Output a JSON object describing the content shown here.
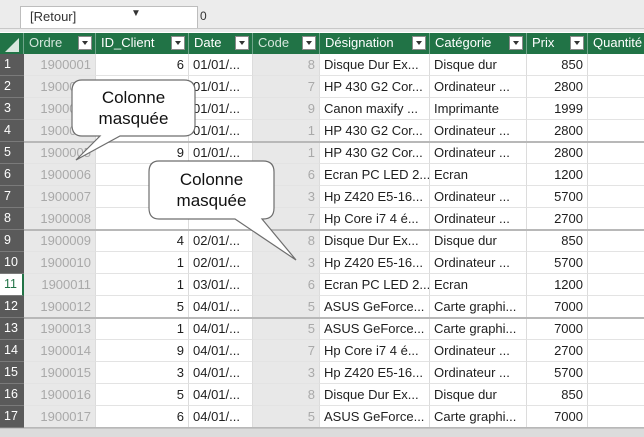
{
  "topbar": {
    "namebox_value": "[Retour]",
    "formula_value": "0"
  },
  "columns": [
    {
      "label": "Ordre",
      "hidden": true
    },
    {
      "label": "ID_Client",
      "hidden": false
    },
    {
      "label": "Date",
      "hidden": false
    },
    {
      "label": "Code",
      "hidden": true
    },
    {
      "label": "Désignation",
      "hidden": false
    },
    {
      "label": "Catégorie",
      "hidden": false
    },
    {
      "label": "Prix",
      "hidden": false
    },
    {
      "label": "Quantité",
      "hidden": false
    }
  ],
  "rows": [
    {
      "n": "1",
      "ordre": "1900001",
      "id": "6",
      "date": "01/01/...",
      "code": "8",
      "des": "Disque Dur Ex...",
      "cat": "Disque dur",
      "prix": "850"
    },
    {
      "n": "2",
      "ordre": "1900002",
      "id": "",
      "date": "01/01/...",
      "code": "7",
      "des": "HP 430 G2 Cor...",
      "cat": "Ordinateur ...",
      "prix": "2800"
    },
    {
      "n": "3",
      "ordre": "1900003",
      "id": "",
      "date": "01/01/...",
      "code": "9",
      "des": "Canon maxify ...",
      "cat": "Imprimante",
      "prix": "1999"
    },
    {
      "n": "4",
      "ordre": "1900004",
      "id": "",
      "date": "01/01/...",
      "code": "1",
      "des": "HP 430 G2 Cor...",
      "cat": "Ordinateur ...",
      "prix": "2800"
    },
    {
      "n": "5",
      "ordre": "1900005",
      "id": "9",
      "date": "01/01/...",
      "code": "1",
      "des": "HP 430 G2 Cor...",
      "cat": "Ordinateur ...",
      "prix": "2800"
    },
    {
      "n": "6",
      "ordre": "1900006",
      "id": "",
      "date": "",
      "code": "6",
      "des": "Ecran PC LED 2...",
      "cat": "Ecran",
      "prix": "1200"
    },
    {
      "n": "7",
      "ordre": "1900007",
      "id": "",
      "date": "",
      "code": "3",
      "des": "Hp Z420 E5-16...",
      "cat": "Ordinateur ...",
      "prix": "5700"
    },
    {
      "n": "8",
      "ordre": "1900008",
      "id": "",
      "date": "",
      "code": "7",
      "des": "Hp Core i7 4 é...",
      "cat": "Ordinateur ...",
      "prix": "2700"
    },
    {
      "n": "9",
      "ordre": "1900009",
      "id": "4",
      "date": "02/01/...",
      "code": "8",
      "des": "Disque Dur Ex...",
      "cat": "Disque dur",
      "prix": "850"
    },
    {
      "n": "10",
      "ordre": "1900010",
      "id": "1",
      "date": "02/01/...",
      "code": "3",
      "des": "Hp Z420 E5-16...",
      "cat": "Ordinateur ...",
      "prix": "5700"
    },
    {
      "n": "11",
      "ordre": "1900011",
      "id": "1",
      "date": "03/01/...",
      "code": "6",
      "des": "Ecran PC LED 2...",
      "cat": "Ecran",
      "prix": "1200"
    },
    {
      "n": "12",
      "ordre": "1900012",
      "id": "5",
      "date": "04/01/...",
      "code": "5",
      "des": "ASUS GeForce...",
      "cat": "Carte graphi...",
      "prix": "7000"
    },
    {
      "n": "13",
      "ordre": "1900013",
      "id": "1",
      "date": "04/01/...",
      "code": "5",
      "des": "ASUS GeForce...",
      "cat": "Carte graphi...",
      "prix": "7000"
    },
    {
      "n": "14",
      "ordre": "1900014",
      "id": "9",
      "date": "04/01/...",
      "code": "7",
      "des": "Hp Core i7 4 é...",
      "cat": "Ordinateur ...",
      "prix": "2700"
    },
    {
      "n": "15",
      "ordre": "1900015",
      "id": "3",
      "date": "04/01/...",
      "code": "3",
      "des": "Hp Z420 E5-16...",
      "cat": "Ordinateur ...",
      "prix": "5700"
    },
    {
      "n": "16",
      "ordre": "1900016",
      "id": "5",
      "date": "04/01/...",
      "code": "8",
      "des": "Disque Dur Ex...",
      "cat": "Disque dur",
      "prix": "850"
    },
    {
      "n": "17",
      "ordre": "1900017",
      "id": "6",
      "date": "04/01/...",
      "code": "5",
      "des": "ASUS GeForce...",
      "cat": "Carte graphi...",
      "prix": "7000"
    }
  ],
  "selected_row": "11",
  "callouts": [
    {
      "line1": "Colonne",
      "line2": "masquée"
    },
    {
      "line1": "Colonne",
      "line2": "masquée"
    }
  ],
  "colors": {
    "header_green": "#217346",
    "hidden_column_gray": "#e8e8e8",
    "row_number_gray": "#5a5a5a"
  }
}
